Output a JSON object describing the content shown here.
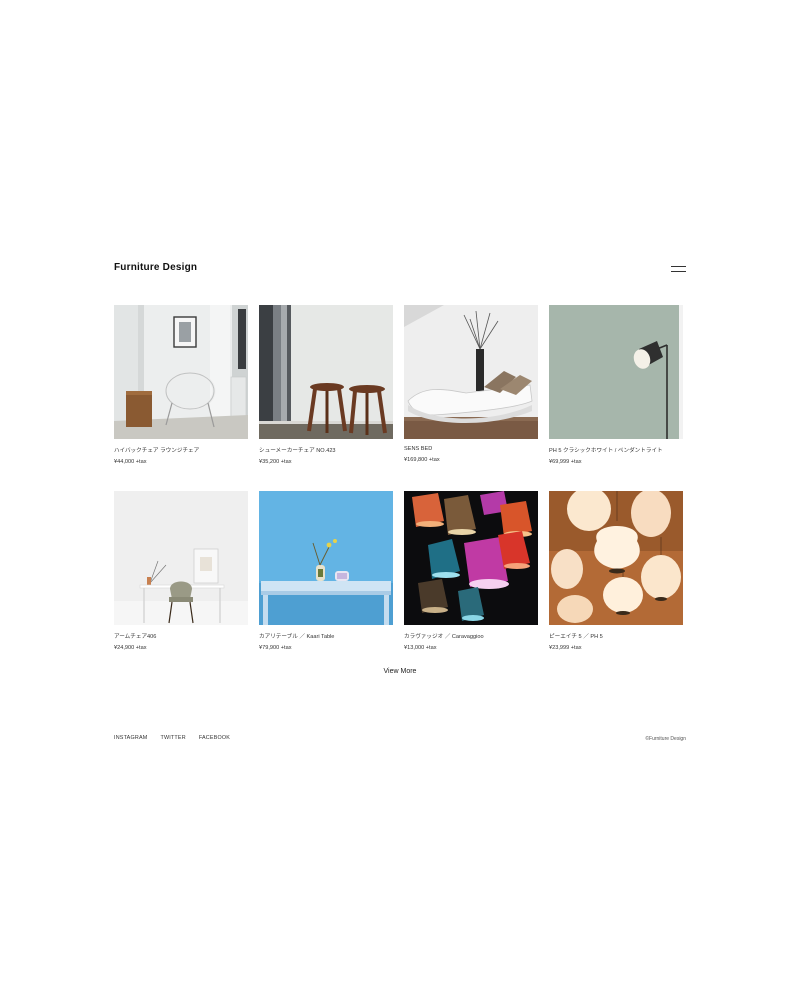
{
  "header": {
    "logo": "Furniture Design",
    "menu_icon": "hamburger-icon"
  },
  "products": [
    {
      "name": "ハイバックチェア ラウンジチェア",
      "price": "¥44,000 +tax"
    },
    {
      "name": "シューメーカーチェア NO.423",
      "price": "¥35,200 +tax"
    },
    {
      "name": "SENS BED",
      "price": "¥169,800 +tax"
    },
    {
      "name": "PH 5 クラシックホワイト / ペンダントライト",
      "price": "¥69,999 +tax"
    },
    {
      "name": "アームチェア406",
      "price": "¥24,900 +tax"
    },
    {
      "name": "カアリテーブル ／ Kaari Table",
      "price": "¥79,900 +tax"
    },
    {
      "name": "カラヴァッジオ ／ Caravaggioo",
      "price": "¥13,000 +tax"
    },
    {
      "name": "ピーエイチ 5 ／ PH 5",
      "price": "¥23,999 +tax"
    }
  ],
  "view_more": "View More",
  "footer": {
    "links": [
      "INSTAGRAM",
      "TWITTER",
      "FACEBOOK"
    ],
    "copyright": "©Furniture Design"
  }
}
